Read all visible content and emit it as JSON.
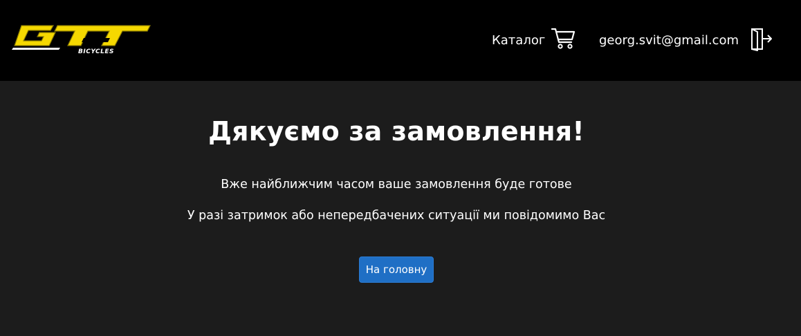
{
  "header": {
    "logo": {
      "text": "GT",
      "subtext": "BICYCLES",
      "icon": "gt-bicycles-logo"
    },
    "nav_catalog_label": "Каталог",
    "cart_icon": "shopping-cart-icon",
    "user_email": "georg.svit@gmail.com",
    "logout_icon": "logout-icon"
  },
  "main": {
    "title": "Дякуємо за замовлення!",
    "message_line1": "Вже найближчим часом ваше замовлення буде готове",
    "message_line2": "У разі затримок або непередбачених ситуації ми повідомимо Вас",
    "home_button_label": "На головну"
  },
  "colors": {
    "header_bg": "#000000",
    "page_bg": "#1c1c1c",
    "logo_yellow": "#f5d800",
    "button_blue": "#1f6fc5",
    "text": "#ffffff"
  }
}
